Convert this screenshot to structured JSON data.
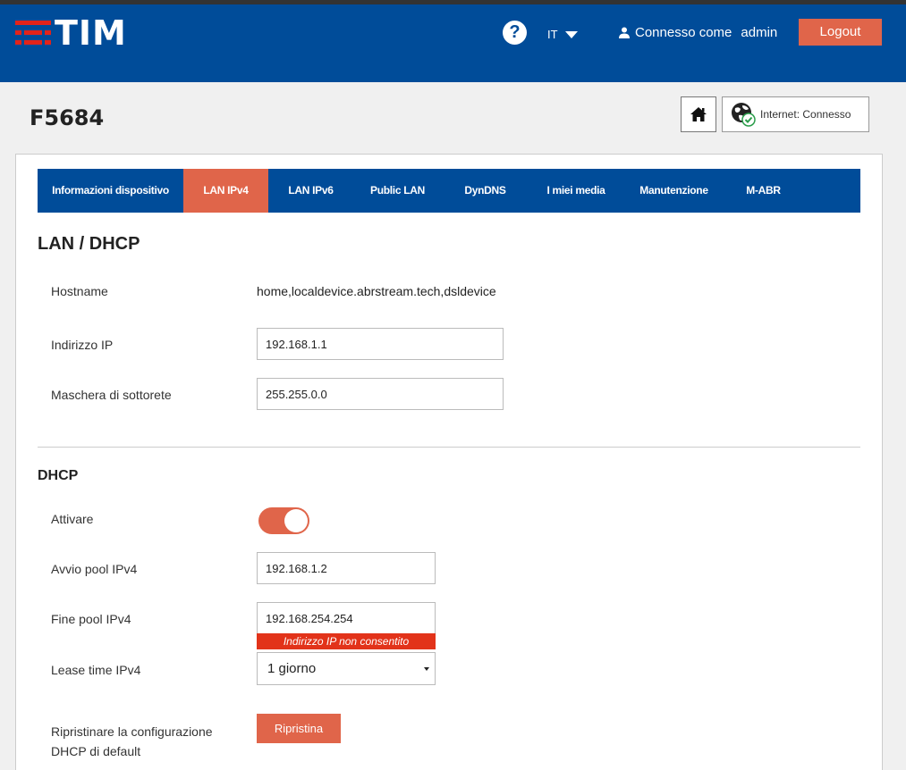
{
  "header": {
    "logo_text": "TIM",
    "help_label": "?",
    "language": "IT",
    "connected_as_label": "Connesso come",
    "username": "admin",
    "logout_label": "Logout"
  },
  "page": {
    "title": "F5684",
    "internet_label": "Internet:",
    "internet_status": "Connesso"
  },
  "tabs": [
    {
      "label": "Informazioni dispositivo",
      "active": false
    },
    {
      "label": "LAN IPv4",
      "active": true
    },
    {
      "label": "LAN IPv6",
      "active": false
    },
    {
      "label": "Public LAN",
      "active": false
    },
    {
      "label": "DynDNS",
      "active": false
    },
    {
      "label": "I miei media",
      "active": false
    },
    {
      "label": "Manutenzione",
      "active": false
    },
    {
      "label": "M-ABR",
      "active": false
    }
  ],
  "lan": {
    "heading": "LAN / DHCP",
    "hostname_label": "Hostname",
    "hostname_value": "home,localdevice.abrstream.tech,dsldevice",
    "ip_label": "Indirizzo IP",
    "ip_value": "192.168.1.1",
    "mask_label": "Maschera di sottorete",
    "mask_value": "255.255.0.0"
  },
  "dhcp": {
    "heading": "DHCP",
    "enable_label": "Attivare",
    "enabled": true,
    "pool_start_label": "Avvio pool IPv4",
    "pool_start_value": "192.168.1.2",
    "pool_end_label": "Fine pool IPv4",
    "pool_end_value": "192.168.254.254",
    "pool_end_error": "Indirizzo IP non consentito",
    "lease_label": "Lease time IPv4",
    "lease_value": "1 giorno",
    "reset_label_line1": "Ripristinare la configurazione",
    "reset_label_line2": "DHCP di default",
    "reset_button": "Ripristina"
  },
  "colors": {
    "brand_blue": "#004c99",
    "accent_orange": "#e0654a",
    "error_red": "#e2331a",
    "logo_red": "#e2231a"
  }
}
